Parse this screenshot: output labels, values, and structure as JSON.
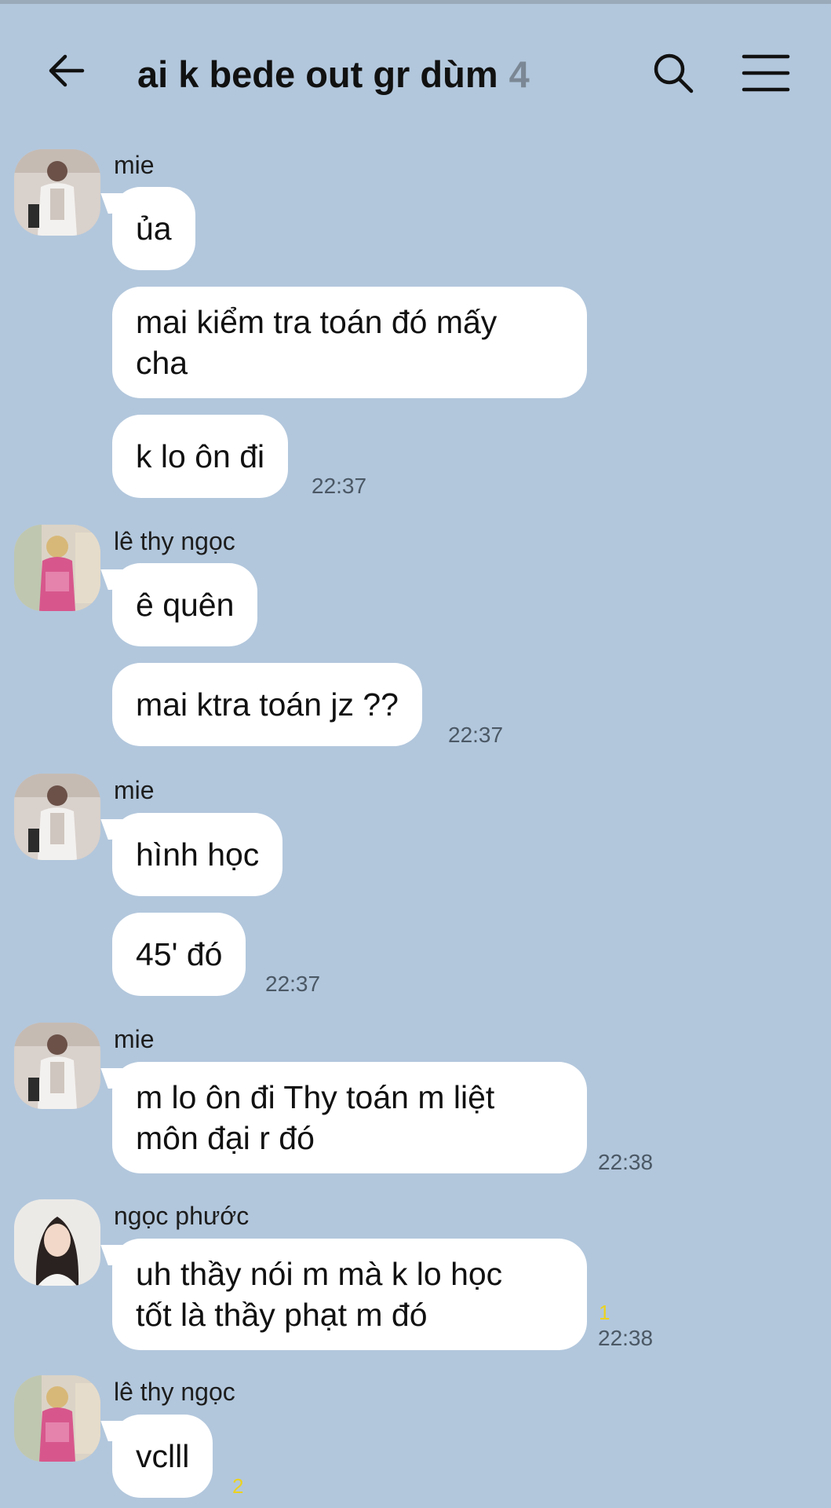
{
  "header": {
    "title": "ai k bede out gr dùm",
    "member_count": "4",
    "icons": {
      "back": "back-arrow-icon",
      "search": "search-icon",
      "menu": "menu-icon"
    }
  },
  "messages": [
    {
      "sender": "mie",
      "bubbles": [
        "ủa",
        "mai kiểm tra toán đó mấy\ncha",
        "k lo ôn đi"
      ],
      "time": "22:37"
    },
    {
      "sender": "lê thy ngọc",
      "bubbles": [
        "ê quên",
        "mai ktra toán jz ??"
      ],
      "time": "22:37"
    },
    {
      "sender": "mie",
      "bubbles": [
        "hình học",
        "45' đó"
      ],
      "time": "22:37"
    },
    {
      "sender": "mie",
      "bubbles": [
        "m lo ôn đi Thy toán m liệt\nmôn đại r đó"
      ],
      "time": "22:38"
    },
    {
      "sender": "ngọc phước",
      "bubbles": [
        "uh thầy nói m mà k lo học\ntốt là thầy phạt m đó"
      ],
      "read_count": "1",
      "time": "22:38"
    },
    {
      "sender": "lê thy ngọc",
      "bubbles": [
        "vclll"
      ],
      "read_count": "2"
    }
  ],
  "colors": {
    "background": "#b2c7dc",
    "bubble": "#ffffff",
    "read_count": "#ecd21f"
  }
}
